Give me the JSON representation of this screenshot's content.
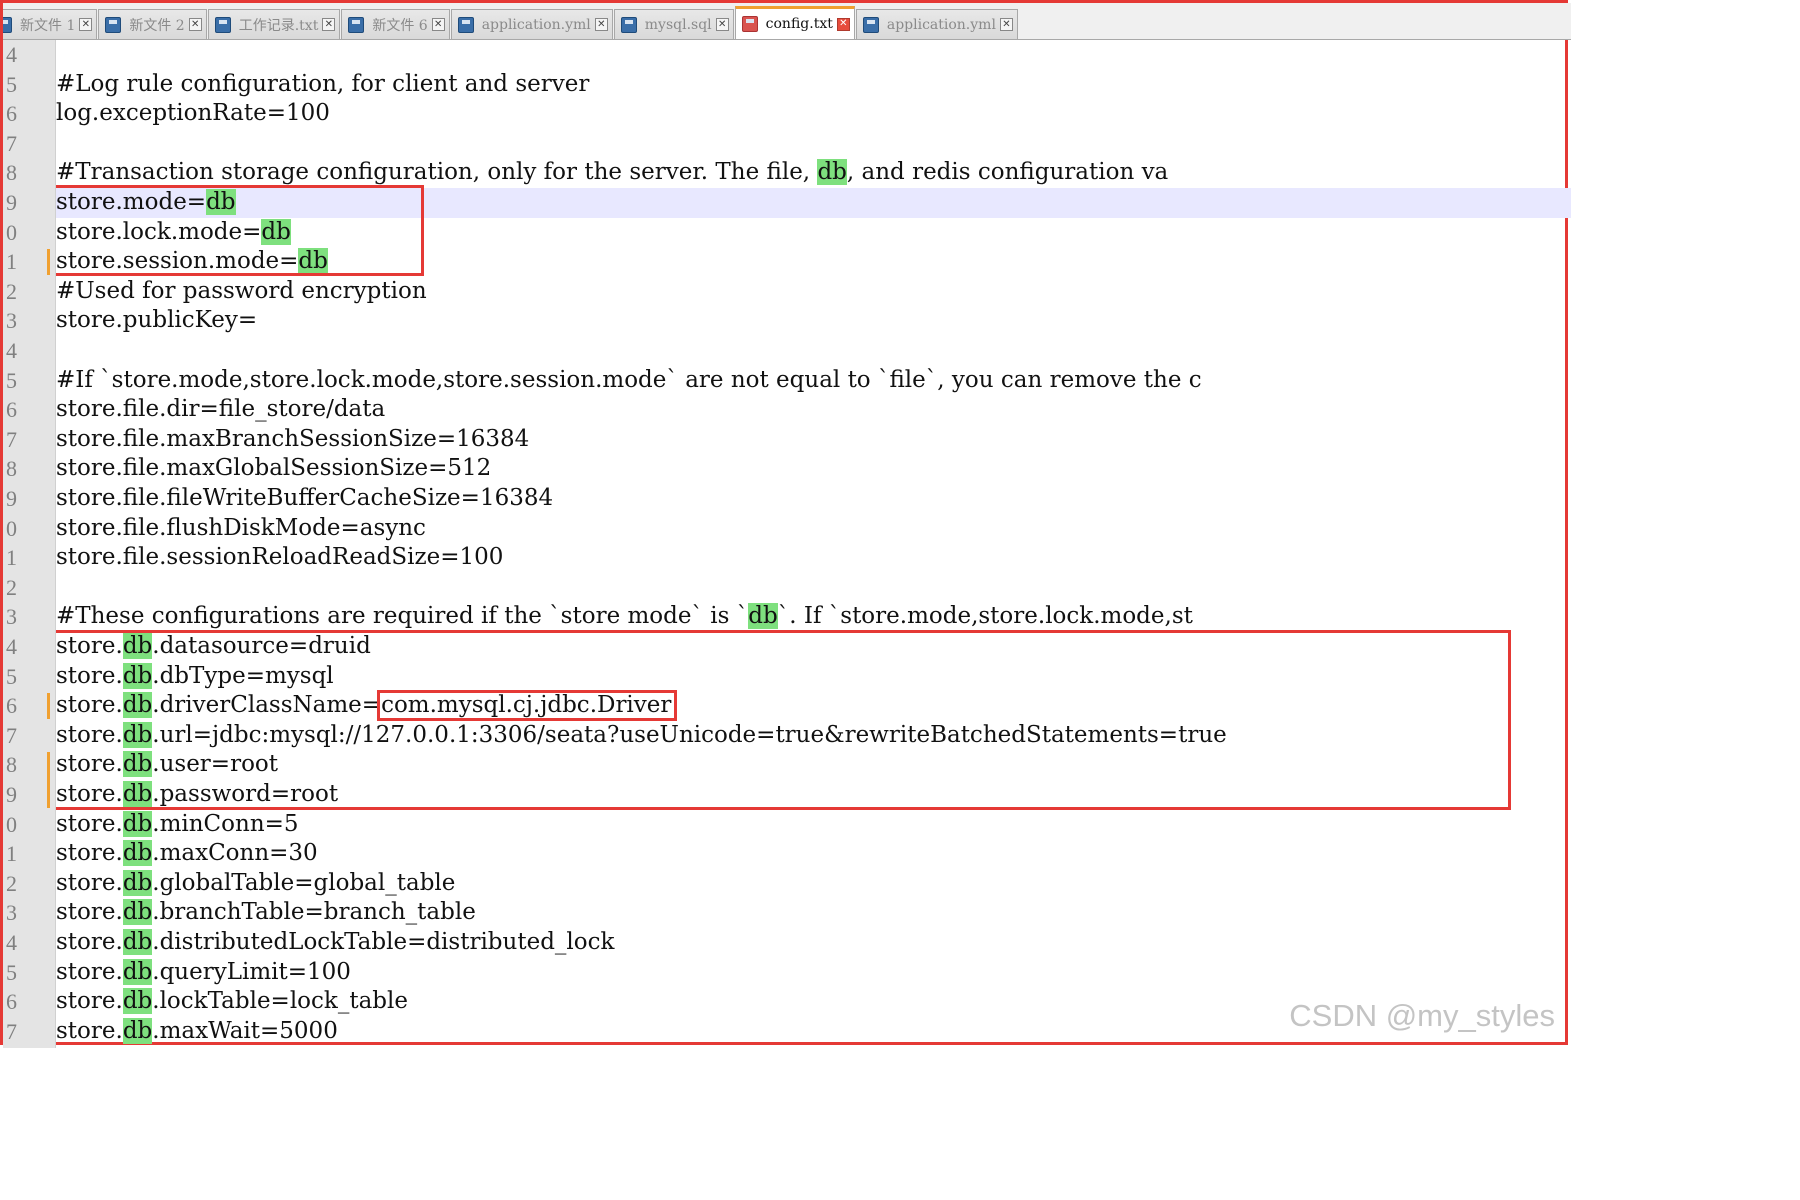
{
  "tabs": [
    {
      "label": "新文件  1",
      "active": false
    },
    {
      "label": "新文件  2",
      "active": false
    },
    {
      "label": "工作记录.txt",
      "active": false
    },
    {
      "label": "新文件  6",
      "active": false
    },
    {
      "label": "application.yml",
      "active": false
    },
    {
      "label": "mysql.sql",
      "active": false
    },
    {
      "label": "config.txt",
      "active": true
    },
    {
      "label": "application.yml",
      "active": false
    }
  ],
  "gutter": [
    "4",
    "5",
    "6",
    "7",
    "8",
    "9",
    "0",
    "1",
    "2",
    "3",
    "4",
    "5",
    "6",
    "7",
    "8",
    "9",
    "0",
    "1",
    "2",
    "3",
    "4",
    "5",
    "6",
    "7",
    "8",
    "9",
    "0",
    "1",
    "2",
    "3",
    "4",
    "5",
    "6",
    "7"
  ],
  "lines": [
    [],
    [
      {
        "t": "#Log rule configuration, for client and server"
      }
    ],
    [
      {
        "t": "log.exceptionRate=100"
      }
    ],
    [],
    [
      {
        "t": "#Transaction storage configuration, only for the server. The file, "
      },
      {
        "t": "db",
        "hl": true
      },
      {
        "t": ", and redis configuration va"
      }
    ],
    [
      {
        "t": "store.mode="
      },
      {
        "t": "db",
        "hl": true
      }
    ],
    [
      {
        "t": "store.lock.mode="
      },
      {
        "t": "db",
        "hl": true
      }
    ],
    [
      {
        "t": "store.session.mode="
      },
      {
        "t": "db",
        "hl": true
      }
    ],
    [
      {
        "t": "#Used for password encryption"
      }
    ],
    [
      {
        "t": "store.publicKey="
      }
    ],
    [],
    [
      {
        "t": "#If `store.mode,store.lock.mode,store.session.mode` are not equal to `file`, you can remove the c"
      }
    ],
    [
      {
        "t": "store.file.dir=file_store/data"
      }
    ],
    [
      {
        "t": "store.file.maxBranchSessionSize=16384"
      }
    ],
    [
      {
        "t": "store.file.maxGlobalSessionSize=512"
      }
    ],
    [
      {
        "t": "store.file.fileWriteBufferCacheSize=16384"
      }
    ],
    [
      {
        "t": "store.file.flushDiskMode=async"
      }
    ],
    [
      {
        "t": "store.file.sessionReloadReadSize=100"
      }
    ],
    [],
    [
      {
        "t": "#These configurations are required if the `store mode` is `"
      },
      {
        "t": "db",
        "hl": true
      },
      {
        "t": "`. If `store.mode,store.lock.mode,st"
      }
    ],
    [
      {
        "t": "store."
      },
      {
        "t": "db",
        "hl": true
      },
      {
        "t": ".datasource=druid"
      }
    ],
    [
      {
        "t": "store."
      },
      {
        "t": "db",
        "hl": true
      },
      {
        "t": ".dbType=mysql"
      }
    ],
    [
      {
        "t": "store."
      },
      {
        "t": "db",
        "hl": true
      },
      {
        "t": ".driverClassName="
      },
      {
        "t": "com.mysql.cj.jdbc.Driver"
      }
    ],
    [
      {
        "t": "store."
      },
      {
        "t": "db",
        "hl": true
      },
      {
        "t": ".url=jdbc:mysql://127.0.0.1:3306/seata?useUnicode=true&rewriteBatchedStatements=true"
      }
    ],
    [
      {
        "t": "store."
      },
      {
        "t": "db",
        "hl": true
      },
      {
        "t": ".user=root"
      }
    ],
    [
      {
        "t": "store."
      },
      {
        "t": "db",
        "hl": true
      },
      {
        "t": ".password=root"
      }
    ],
    [
      {
        "t": "store."
      },
      {
        "t": "db",
        "hl": true
      },
      {
        "t": ".minConn=5"
      }
    ],
    [
      {
        "t": "store."
      },
      {
        "t": "db",
        "hl": true
      },
      {
        "t": ".maxConn=30"
      }
    ],
    [
      {
        "t": "store."
      },
      {
        "t": "db",
        "hl": true
      },
      {
        "t": ".globalTable=global_table"
      }
    ],
    [
      {
        "t": "store."
      },
      {
        "t": "db",
        "hl": true
      },
      {
        "t": ".branchTable=branch_table"
      }
    ],
    [
      {
        "t": "store."
      },
      {
        "t": "db",
        "hl": true
      },
      {
        "t": ".distributedLockTable=distributed_lock"
      }
    ],
    [
      {
        "t": "store."
      },
      {
        "t": "db",
        "hl": true
      },
      {
        "t": ".queryLimit=100"
      }
    ],
    [
      {
        "t": "store."
      },
      {
        "t": "db",
        "hl": true
      },
      {
        "t": ".lockTable=lock_table"
      }
    ],
    [
      {
        "t": "store."
      },
      {
        "t": "db",
        "hl": true
      },
      {
        "t": ".maxWait=5000"
      }
    ]
  ],
  "current_line": 5,
  "watermark": "CSDN @my_styles",
  "colors": {
    "annotation_box": "#e53935",
    "match_highlight": "#7ee07e",
    "current_line": "#e8e8ff",
    "gutter": "#e4e4e4",
    "change_marker": "#f0a030"
  },
  "icons": {
    "tab_file": "save-disk-icon",
    "tab_close": "close-icon"
  }
}
